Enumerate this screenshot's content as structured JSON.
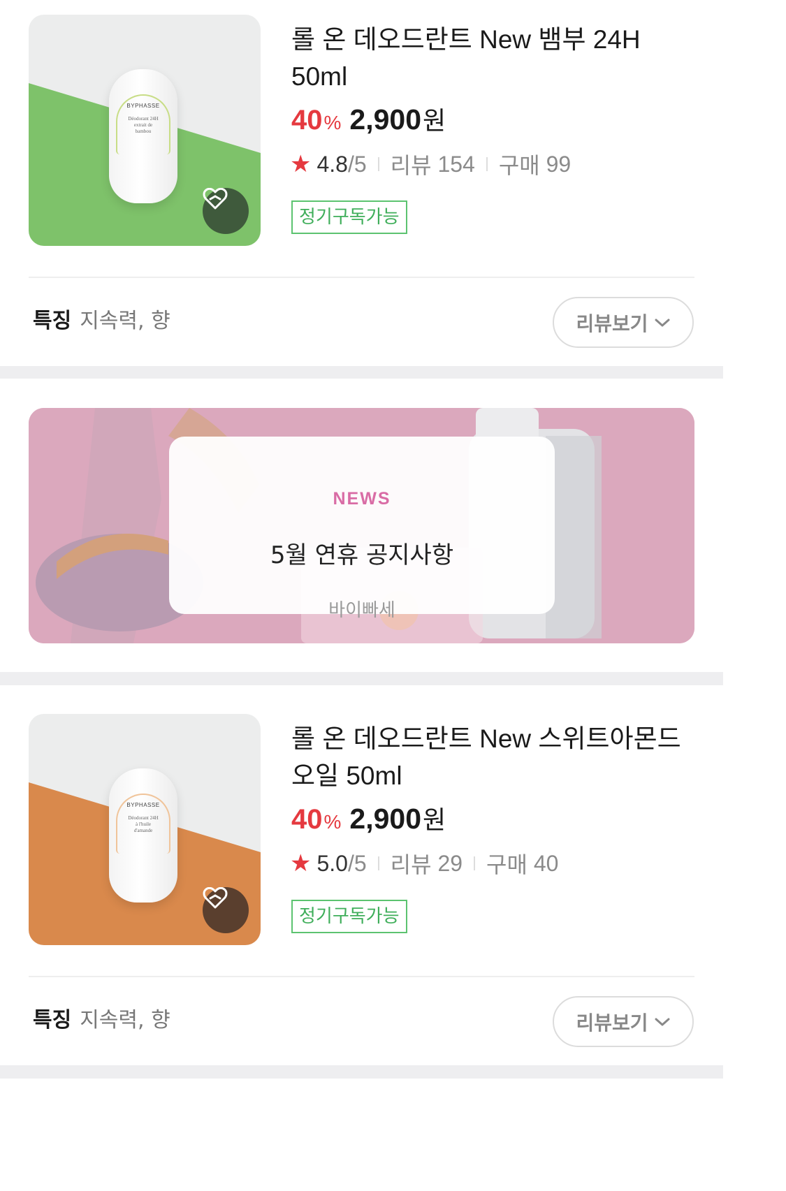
{
  "products": [
    {
      "title": "롤 온 데오드란트 New 뱀부 24H 50ml",
      "discount": "40",
      "discount_unit": "%",
      "price": "2,900",
      "currency": "원",
      "rating": "4.8",
      "rating_max": "/5",
      "review_label": "리뷰",
      "review_count": "154",
      "purchase_label": "구매",
      "purchase_count": "99",
      "badge": "정기구독가능",
      "feature_label": "특징",
      "feature_value": "지속력, 향",
      "review_button": "리뷰보기",
      "image": {
        "brand": "BYPHASSE",
        "line1": "Déodorant 24H",
        "line2": "extrait de",
        "line3": "bambou",
        "accent": "#7ec26a",
        "label_color": "#c8dd86",
        "heart_bg": "#3f5a3c"
      }
    },
    {
      "title": "롤 온 데오드란트 New 스위트아몬드오일 50ml",
      "discount": "40",
      "discount_unit": "%",
      "price": "2,900",
      "currency": "원",
      "rating": "5.0",
      "rating_max": "/5",
      "review_label": "리뷰",
      "review_count": "29",
      "purchase_label": "구매",
      "purchase_count": "40",
      "badge": "정기구독가능",
      "feature_label": "특징",
      "feature_value": "지속력, 향",
      "review_button": "리뷰보기",
      "image": {
        "brand": "BYPHASSE",
        "line1": "Déodorant 24H",
        "line2": "à l'huile",
        "line3": "d'amande",
        "accent": "#d9894c",
        "label_color": "#f0c49a",
        "heart_bg": "#5a3f2e"
      }
    }
  ],
  "news": {
    "tag": "NEWS",
    "title": "5월 연휴 공지사항",
    "source": "바이빠세"
  },
  "colors": {
    "discount": "#e5393f",
    "badge_green": "#3fae5a",
    "news_tag": "#d96ca5",
    "banner_bg": "#dba8bd",
    "section_gap": "#eeeef0"
  },
  "icons": [
    "heart-icon",
    "star-icon",
    "chevron-down-icon"
  ]
}
